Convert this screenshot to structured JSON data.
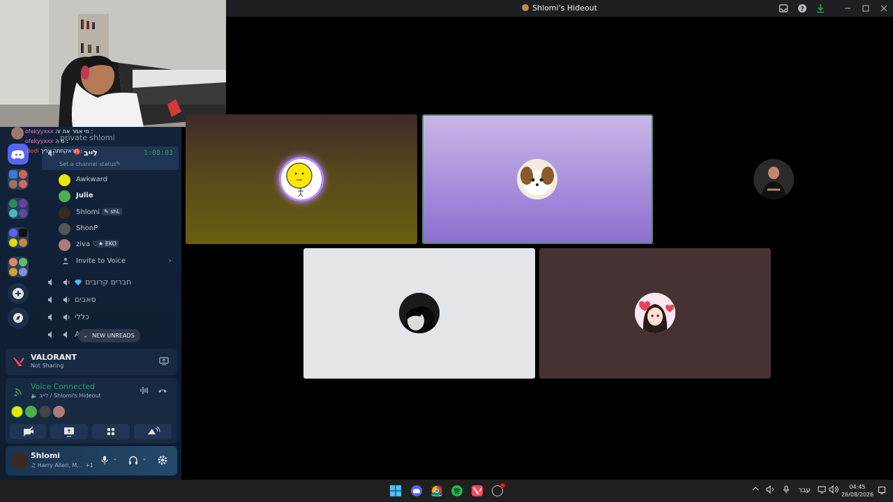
{
  "window": {
    "title": "Shlomi's Hideout"
  },
  "stream_chat": [
    {
      "user": "ofekyyxxx",
      "message": "מי אמר את זה :",
      "color": "#ff66cc"
    },
    {
      "user": "ofekyyxxx",
      "message": "מ ה :",
      "color": "#ff66cc"
    },
    {
      "user": "idodi",
      "message": "תראקחתה צריך :",
      "color": "#ff5c5c"
    }
  ],
  "sidebar": {
    "channel_header": "private shlomi",
    "active_voice": {
      "name": "לייב",
      "timer": "1:08:03",
      "status_placeholder": "Set a channel status"
    },
    "members": [
      {
        "name": "Awkward",
        "tag": "",
        "color": "#e8e800"
      },
      {
        "name": "Julie",
        "tag": "",
        "color": "#4caf50"
      },
      {
        "name": "5hlomi",
        "tag": "shL",
        "color": "#3b2a22"
      },
      {
        "name": "ShonP",
        "tag": "",
        "color": "#555"
      },
      {
        "name": "ziva ♡",
        "tag": "EKO",
        "color": "#b07a7a"
      }
    ],
    "invite_label": "Invite to Voice",
    "channels": [
      {
        "name": "חברים קרובים"
      },
      {
        "name": "סאבים"
      },
      {
        "name": "כללי"
      },
      {
        "name": "AF"
      }
    ],
    "new_unreads": "NEW UNREADS"
  },
  "activity": {
    "game": "VALORANT",
    "status": "Not Sharing"
  },
  "voice": {
    "state": "Voice Connected",
    "location": "לייב / Shlomi's Hideout"
  },
  "user_panel": {
    "name": "5hlomi",
    "activity": "Harry Allen, M...",
    "extra": "+1"
  },
  "taskbar": {
    "lang": "עבר",
    "time": "04:45",
    "date": "26/08/2026"
  },
  "colors": {
    "accent": "#5865f2",
    "voice_green": "#23a55a"
  }
}
